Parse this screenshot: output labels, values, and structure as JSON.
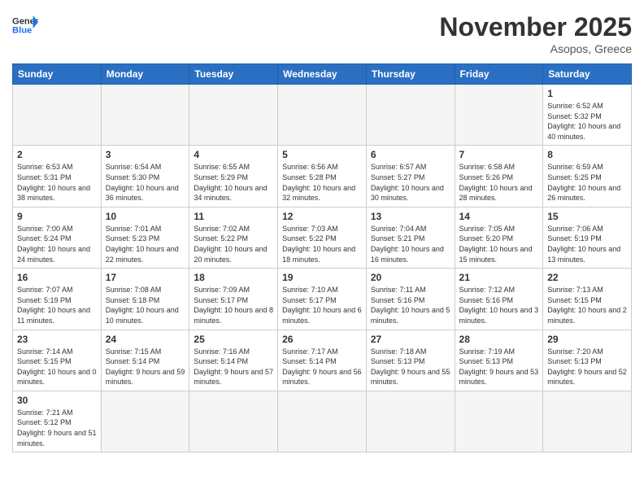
{
  "header": {
    "logo_general": "General",
    "logo_blue": "Blue",
    "month_title": "November 2025",
    "location": "Asopos, Greece"
  },
  "weekdays": [
    "Sunday",
    "Monday",
    "Tuesday",
    "Wednesday",
    "Thursday",
    "Friday",
    "Saturday"
  ],
  "days": {
    "1": {
      "sunrise": "6:52 AM",
      "sunset": "5:32 PM",
      "daylight": "10 hours and 40 minutes."
    },
    "2": {
      "sunrise": "6:53 AM",
      "sunset": "5:31 PM",
      "daylight": "10 hours and 38 minutes."
    },
    "3": {
      "sunrise": "6:54 AM",
      "sunset": "5:30 PM",
      "daylight": "10 hours and 36 minutes."
    },
    "4": {
      "sunrise": "6:55 AM",
      "sunset": "5:29 PM",
      "daylight": "10 hours and 34 minutes."
    },
    "5": {
      "sunrise": "6:56 AM",
      "sunset": "5:28 PM",
      "daylight": "10 hours and 32 minutes."
    },
    "6": {
      "sunrise": "6:57 AM",
      "sunset": "5:27 PM",
      "daylight": "10 hours and 30 minutes."
    },
    "7": {
      "sunrise": "6:58 AM",
      "sunset": "5:26 PM",
      "daylight": "10 hours and 28 minutes."
    },
    "8": {
      "sunrise": "6:59 AM",
      "sunset": "5:25 PM",
      "daylight": "10 hours and 26 minutes."
    },
    "9": {
      "sunrise": "7:00 AM",
      "sunset": "5:24 PM",
      "daylight": "10 hours and 24 minutes."
    },
    "10": {
      "sunrise": "7:01 AM",
      "sunset": "5:23 PM",
      "daylight": "10 hours and 22 minutes."
    },
    "11": {
      "sunrise": "7:02 AM",
      "sunset": "5:22 PM",
      "daylight": "10 hours and 20 minutes."
    },
    "12": {
      "sunrise": "7:03 AM",
      "sunset": "5:22 PM",
      "daylight": "10 hours and 18 minutes."
    },
    "13": {
      "sunrise": "7:04 AM",
      "sunset": "5:21 PM",
      "daylight": "10 hours and 16 minutes."
    },
    "14": {
      "sunrise": "7:05 AM",
      "sunset": "5:20 PM",
      "daylight": "10 hours and 15 minutes."
    },
    "15": {
      "sunrise": "7:06 AM",
      "sunset": "5:19 PM",
      "daylight": "10 hours and 13 minutes."
    },
    "16": {
      "sunrise": "7:07 AM",
      "sunset": "5:19 PM",
      "daylight": "10 hours and 11 minutes."
    },
    "17": {
      "sunrise": "7:08 AM",
      "sunset": "5:18 PM",
      "daylight": "10 hours and 10 minutes."
    },
    "18": {
      "sunrise": "7:09 AM",
      "sunset": "5:17 PM",
      "daylight": "10 hours and 8 minutes."
    },
    "19": {
      "sunrise": "7:10 AM",
      "sunset": "5:17 PM",
      "daylight": "10 hours and 6 minutes."
    },
    "20": {
      "sunrise": "7:11 AM",
      "sunset": "5:16 PM",
      "daylight": "10 hours and 5 minutes."
    },
    "21": {
      "sunrise": "7:12 AM",
      "sunset": "5:16 PM",
      "daylight": "10 hours and 3 minutes."
    },
    "22": {
      "sunrise": "7:13 AM",
      "sunset": "5:15 PM",
      "daylight": "10 hours and 2 minutes."
    },
    "23": {
      "sunrise": "7:14 AM",
      "sunset": "5:15 PM",
      "daylight": "10 hours and 0 minutes."
    },
    "24": {
      "sunrise": "7:15 AM",
      "sunset": "5:14 PM",
      "daylight": "9 hours and 59 minutes."
    },
    "25": {
      "sunrise": "7:16 AM",
      "sunset": "5:14 PM",
      "daylight": "9 hours and 57 minutes."
    },
    "26": {
      "sunrise": "7:17 AM",
      "sunset": "5:14 PM",
      "daylight": "9 hours and 56 minutes."
    },
    "27": {
      "sunrise": "7:18 AM",
      "sunset": "5:13 PM",
      "daylight": "9 hours and 55 minutes."
    },
    "28": {
      "sunrise": "7:19 AM",
      "sunset": "5:13 PM",
      "daylight": "9 hours and 53 minutes."
    },
    "29": {
      "sunrise": "7:20 AM",
      "sunset": "5:13 PM",
      "daylight": "9 hours and 52 minutes."
    },
    "30": {
      "sunrise": "7:21 AM",
      "sunset": "5:12 PM",
      "daylight": "9 hours and 51 minutes."
    }
  }
}
